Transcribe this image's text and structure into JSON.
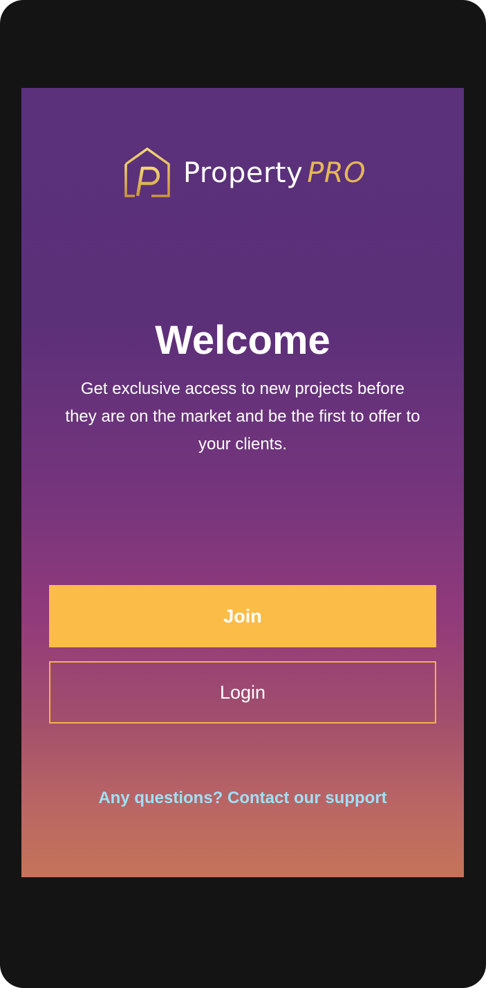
{
  "brand": {
    "name_primary": "Property",
    "name_secondary": "PRO",
    "logo_icon": "house-p-logo-icon",
    "accent_color": "#e4b75a"
  },
  "welcome": {
    "title": "Welcome",
    "subtitle": "Get exclusive access to new projects before they are on the market and be the first to offer to your clients."
  },
  "actions": {
    "join_label": "Join",
    "login_label": "Login",
    "join_color": "#fbbd48"
  },
  "support": {
    "text": "Any questions? Contact our support",
    "color": "#9ee0f8"
  }
}
